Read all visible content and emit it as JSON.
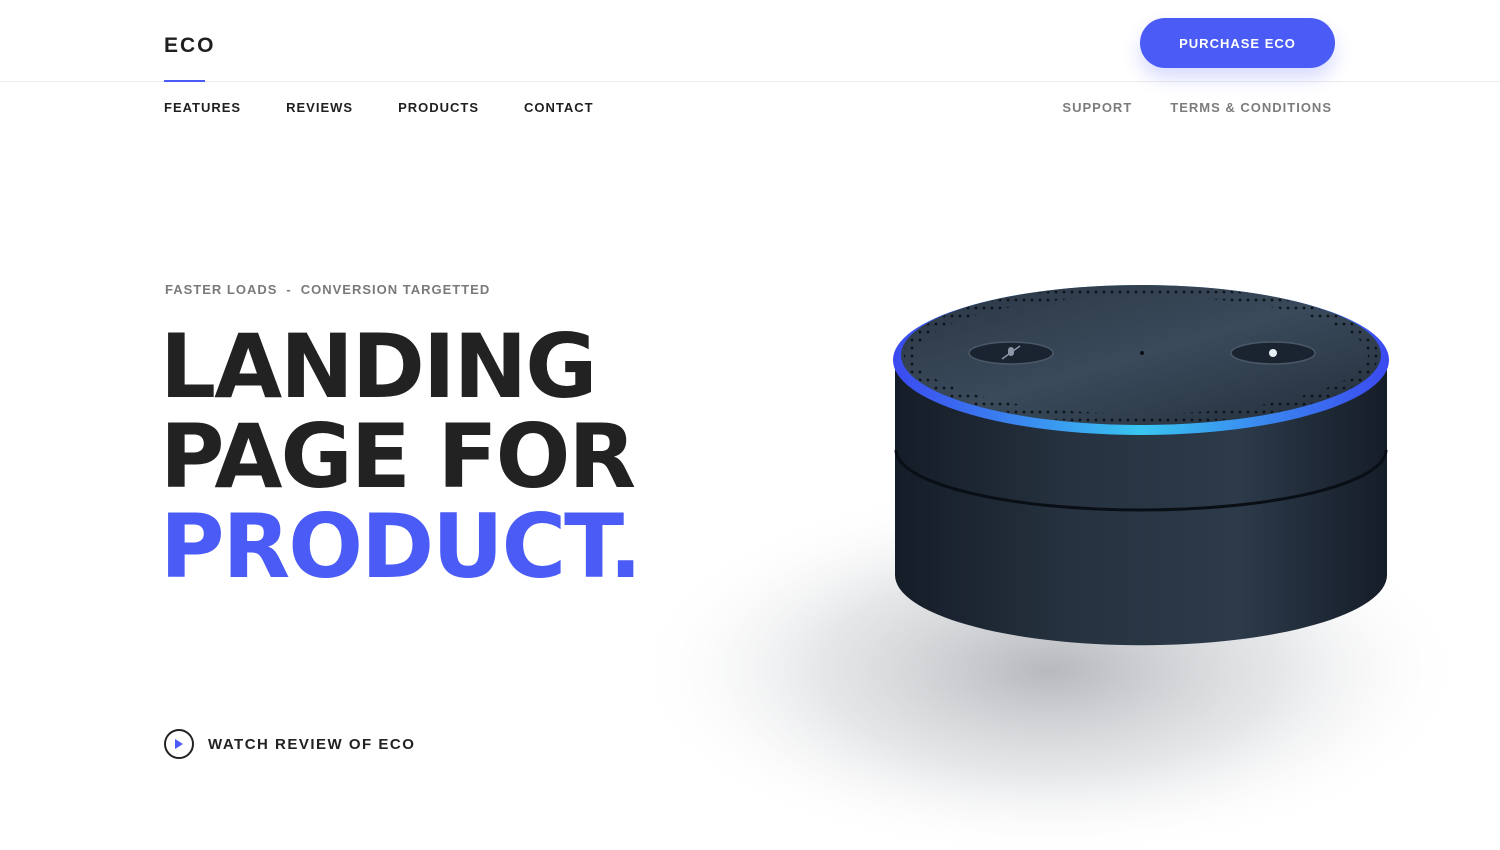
{
  "header": {
    "logo": "ECO",
    "purchase_label": "PURCHASE ECO"
  },
  "nav": {
    "left": [
      {
        "label": "FEATURES"
      },
      {
        "label": "REVIEWS"
      },
      {
        "label": "PRODUCTS"
      },
      {
        "label": "CONTACT"
      }
    ],
    "right": [
      {
        "label": "SUPPORT"
      },
      {
        "label": "TERMS & CONDITIONS"
      }
    ]
  },
  "hero": {
    "tagline_1": "FASTER LOADS",
    "tagline_sep": "-",
    "tagline_2": "CONVERSION TARGETTED",
    "headline_1": "LANDING",
    "headline_2": "PAGE FOR",
    "headline_3": "PRODUCT.",
    "watch_label": "WATCH REVIEW OF ECO"
  },
  "colors": {
    "accent": "#4a5cf5",
    "text_dark": "#222222",
    "text_muted": "#7a7a7a",
    "device_body": "#1f2a38",
    "light_ring": "#4a5cf5"
  },
  "icons": {
    "play": "play-icon",
    "mic": "microphone-icon",
    "action": "action-button-icon"
  }
}
